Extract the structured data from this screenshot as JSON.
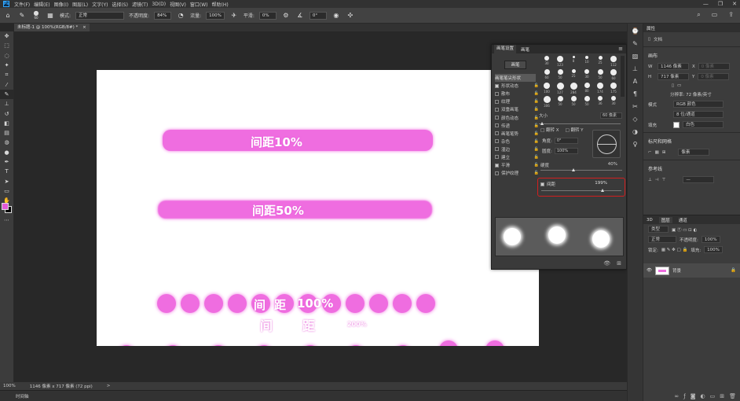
{
  "app": {
    "logo_letter": "Ps",
    "menu": [
      "文件(F)",
      "编辑(E)",
      "图像(I)",
      "图层(L)",
      "文字(Y)",
      "选择(S)",
      "滤镜(T)",
      "3D(D)",
      "视图(V)",
      "窗口(W)",
      "帮助(H)"
    ],
    "window_controls": [
      "—",
      "❐",
      "✕"
    ]
  },
  "options_bar": {
    "brush_size": "60",
    "mode_label": "模式:",
    "mode_value": "正常",
    "opacity_label": "不透明度:",
    "opacity_value": "84%",
    "flow_label": "流量:",
    "flow_value": "100%",
    "smooth_label": "平滑:",
    "smooth_value": "0%",
    "angle_value": "0°"
  },
  "document": {
    "tab_title": "未标题-1 @ 100%(RGB/8#) *",
    "close": "×"
  },
  "canvas": {
    "brush_color": "#ef6de0",
    "labels": {
      "row1": "间距10%",
      "row2": "间距50%",
      "row3_a": "间",
      "row3_b": "距",
      "row3_c": "100%",
      "row4_a": "间",
      "row4_b": "距",
      "row4_c": "200%"
    }
  },
  "status_bar": {
    "zoom": "100%",
    "doc_info": "1146 像素 x 717 像素 (72 ppi)",
    "arrow": ">"
  },
  "timeline": {
    "label": "时间轴"
  },
  "brush_panel": {
    "tabs": [
      "画笔设置",
      "画笔"
    ],
    "brush_button": "画笔",
    "options": [
      {
        "label": "画笔笔尖形状",
        "checked": null,
        "header": true
      },
      {
        "label": "形状动态",
        "checked": true
      },
      {
        "label": "散布",
        "checked": false
      },
      {
        "label": "纹理",
        "checked": false
      },
      {
        "label": "双重画笔",
        "checked": false
      },
      {
        "label": "颜色动态",
        "checked": false
      },
      {
        "label": "传递",
        "checked": false
      },
      {
        "label": "画笔笔势",
        "checked": false
      },
      {
        "label": "杂色",
        "checked": false
      },
      {
        "label": "湿边",
        "checked": false
      },
      {
        "label": "建立",
        "checked": false
      },
      {
        "label": "平滑",
        "checked": true
      },
      {
        "label": "保护纹理",
        "checked": false
      }
    ],
    "presets": [
      "30",
      "123",
      "8",
      "10",
      "25",
      "112",
      "60",
      "50",
      "25",
      "30",
      "50",
      "60",
      "100",
      "127",
      "284",
      "80",
      "174",
      "175",
      "306",
      "50",
      "50",
      "50",
      "36",
      "30"
    ],
    "size_label": "大小",
    "size_value": "60 像素",
    "flip_x": "翻转 X",
    "flip_y": "翻转 Y",
    "angle_label": "角度:",
    "angle_value": "0°",
    "roundness_label": "圆度:",
    "roundness_value": "100%",
    "hardness_label": "硬度",
    "hardness_value": "40%",
    "spacing_label": "间距",
    "spacing_value": "199%",
    "highlight_color": "#d21f1f"
  },
  "properties_panel": {
    "tabs": [
      "属性"
    ],
    "doc_label": "文档",
    "canvas_section": "画布",
    "w_label": "W",
    "w_value": "1146 像素",
    "h_label": "H",
    "h_value": "717 像素",
    "x_label": "X",
    "x_value": "0 像素",
    "y_label": "Y",
    "y_value": "0 像素",
    "resolution": "分辨率: 72 像素/英寸",
    "mode_label": "模式",
    "mode_value": "RGB 颜色",
    "depth_value": "8 位/通道",
    "fill_label": "填充",
    "fill_value": "白色",
    "rulers_section": "标尺和网格",
    "rulers_unit": "像素",
    "guides_section": "参考线"
  },
  "layers_panel": {
    "tabs": [
      "3D",
      "图层",
      "通道"
    ],
    "kind_label": "类型",
    "blend_value": "正常",
    "opacity_label": "不透明度:",
    "opacity_value": "100%",
    "lock_label": "锁定:",
    "fill_label": "填充:",
    "fill_value": "100%",
    "layer_name": "背景"
  }
}
